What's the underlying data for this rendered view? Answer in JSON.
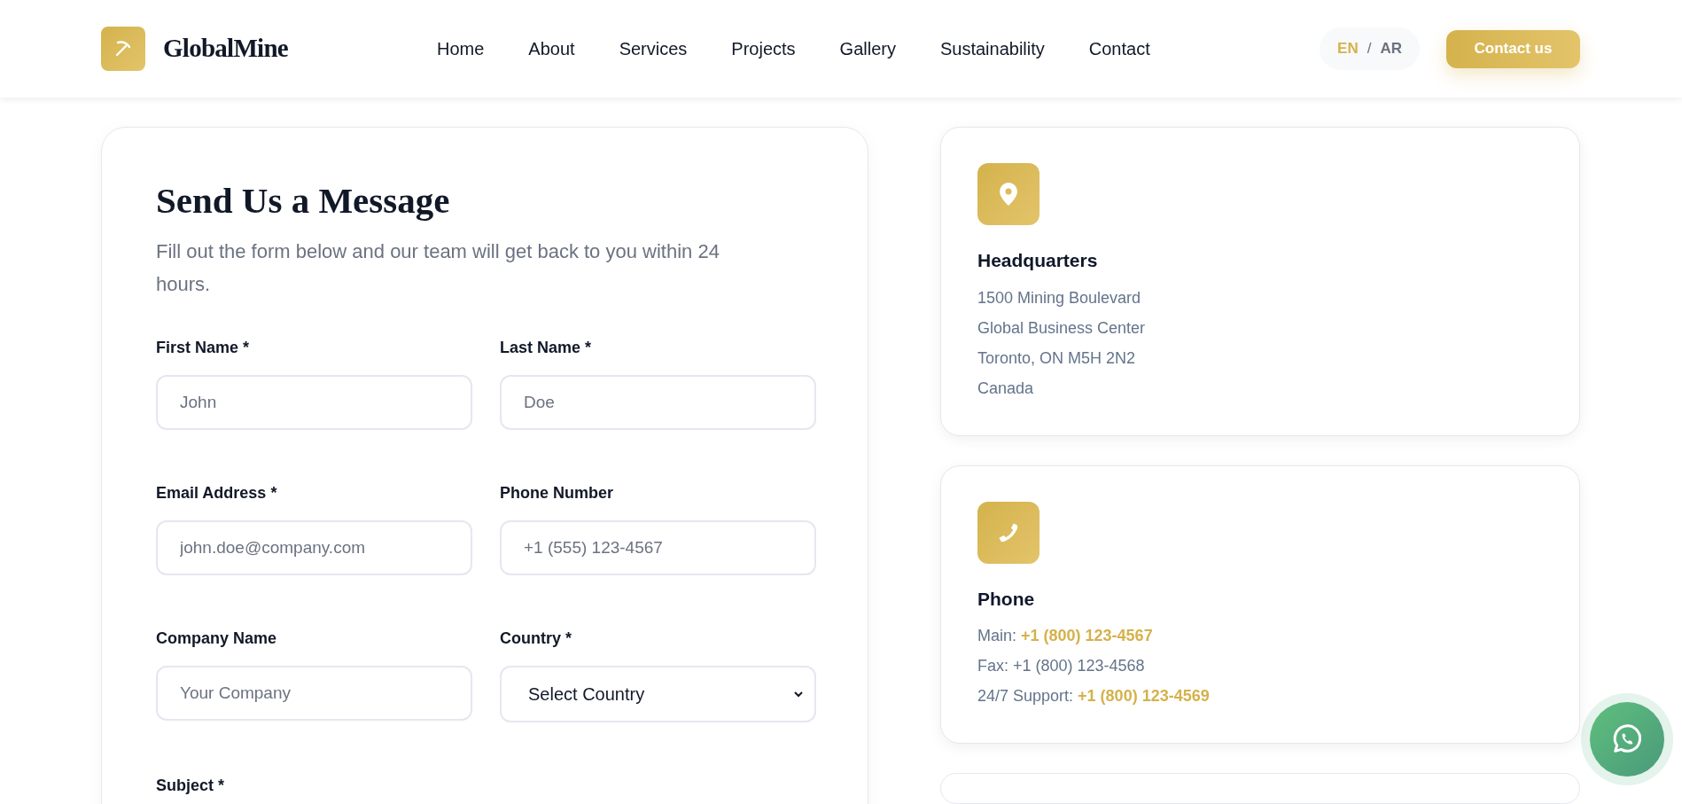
{
  "header": {
    "logo_text": "GlobalMine",
    "nav": [
      {
        "label": "Home"
      },
      {
        "label": "About"
      },
      {
        "label": "Services"
      },
      {
        "label": "Projects"
      },
      {
        "label": "Gallery"
      },
      {
        "label": "Sustainability"
      },
      {
        "label": "Contact"
      }
    ],
    "languages": [
      {
        "label": "EN",
        "selected": true
      },
      {
        "label": "AR",
        "selected": false
      }
    ],
    "language_separator": "/",
    "cta": "Contact us"
  },
  "form": {
    "title": "Send Us a Message",
    "subtitle": "Fill out the form below and our team will get back to you within 24 hours.",
    "fields": [
      {
        "label": "First Name *",
        "kind": "input",
        "placeholder": "John"
      },
      {
        "label": "Last Name *",
        "kind": "input",
        "placeholder": "Doe"
      },
      {
        "label": "Email Address *",
        "kind": "input",
        "placeholder": "john.doe@company.com"
      },
      {
        "label": "Phone Number",
        "kind": "input",
        "placeholder": "+1 (555) 123-4567"
      },
      {
        "label": "Company Name",
        "kind": "input",
        "placeholder": "Your Company"
      },
      {
        "label": "Country *",
        "kind": "select",
        "value": "Select Country"
      },
      {
        "label": "Subject *",
        "kind": "label_only"
      }
    ]
  },
  "info_cards": [
    {
      "kind": "address",
      "title": "Headquarters",
      "lines": [
        {
          "label": "1500 Mining Boulevard"
        },
        {
          "label": "Global Business Center"
        },
        {
          "label": "Toronto, ON M5H 2N2"
        },
        {
          "label": "Canada"
        }
      ]
    },
    {
      "kind": "phone",
      "title": "Phone",
      "lines": [
        {
          "label": "Main:",
          "value": "+1 (800) 123-4567",
          "highlight": true
        },
        {
          "label": "Fax:",
          "value": "+1 (800) 123-4568",
          "highlight": false
        },
        {
          "label": "24/7 Support:",
          "value": "+1 (800) 123-4569",
          "highlight": true
        }
      ]
    }
  ]
}
